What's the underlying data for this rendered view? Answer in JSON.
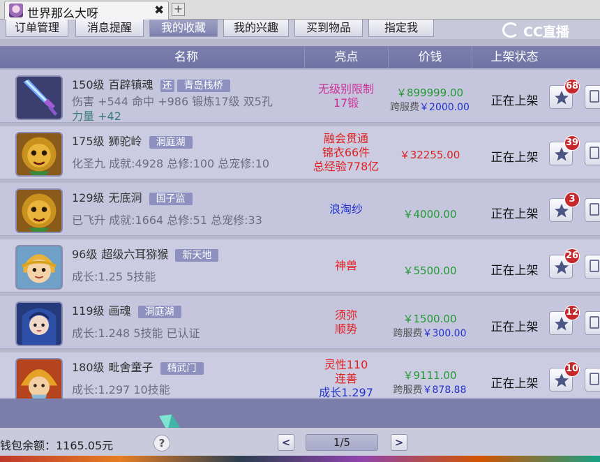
{
  "tab": {
    "title": "世界那么大呀",
    "close": "✖",
    "new": "+"
  },
  "subnav": [
    {
      "label": "订单管理",
      "active": false
    },
    {
      "label": "消息提醒",
      "active": false
    },
    {
      "label": "我的收藏",
      "active": true
    },
    {
      "label": "我的兴趣",
      "active": false
    },
    {
      "label": "买到物品",
      "active": false
    },
    {
      "label": "指定我",
      "active": false
    }
  ],
  "logo": {
    "text": "CC直播"
  },
  "columns": [
    "名称",
    "亮点",
    "价钱",
    "上架状态"
  ],
  "rows": [
    {
      "level": "150级",
      "name": "百辟镇魂",
      "tag": "还",
      "server": "青岛栈桥",
      "detail": "伤害 +544 命中 +986 锻炼17级 双5孔",
      "extra_label": "力量",
      "extra_value": "+42",
      "highlight": [
        "无级别限制",
        "17锻"
      ],
      "highlight_color": "#cc3399",
      "price": "￥899999.00",
      "price_red": false,
      "fee_label": "跨服费",
      "fee": "￥2000.00",
      "status": "正在上架",
      "fav_count": "68"
    },
    {
      "level": "175级",
      "name": "狮驼岭",
      "server": "洞庭湖",
      "detail": "化圣九 成就:4928 总修:100 总宠修:10",
      "highlight": [
        "融会贯通",
        "锦衣66件",
        "总经验778亿"
      ],
      "highlight_color": "#e02020",
      "price": "￥32255.00",
      "price_red": true,
      "status": "正在上架",
      "fav_count": "39"
    },
    {
      "level": "129级",
      "name": "无底洞",
      "server": "国子监",
      "detail": "已飞升 成就:1664 总修:51 总宠修:33",
      "highlight": [
        "浪淘纱"
      ],
      "highlight_color": "#2233cc",
      "price": "￥4000.00",
      "price_red": false,
      "status": "正在上架",
      "fav_count": "3"
    },
    {
      "level": "96级",
      "name": "超级六耳猕猴",
      "server": "新天地",
      "detail": "成长:1.25 5技能",
      "highlight": [
        "神兽"
      ],
      "highlight_color": "#e02020",
      "price": "￥5500.00",
      "price_red": false,
      "status": "正在上架",
      "fav_count": "26"
    },
    {
      "level": "119级",
      "name": "画魂",
      "server": "洞庭湖",
      "detail": "成长:1.248 5技能 已认证",
      "highlight": [
        "须弥",
        "顺势"
      ],
      "highlight_color": "#e02020",
      "price": "￥1500.00",
      "price_red": false,
      "fee_label": "跨服费",
      "fee": "￥300.00",
      "status": "正在上架",
      "fav_count": "12"
    },
    {
      "level": "180级",
      "name": "毗舍童子",
      "server": "精武门",
      "detail": "成长:1.297 10技能",
      "highlight": [
        "灵性110",
        "连善",
        "成长1.297"
      ],
      "highlight_color": "#e02020",
      "price": "￥9111.00",
      "price_red": false,
      "fee_label": "跨服费",
      "fee": "￥878.88",
      "status": "正在上架",
      "fav_count": "10"
    }
  ],
  "footer": {
    "wallet": "钱包余额：1165.05元",
    "help": "?",
    "prev": "<",
    "next": ">",
    "page": "1/5"
  },
  "colors": {
    "header": "#7c7fae",
    "row": "#c5c6dd",
    "accent": "#c6272b"
  },
  "icons": [
    "star-icon",
    "cart-icon",
    "help-icon",
    "close-icon"
  ]
}
